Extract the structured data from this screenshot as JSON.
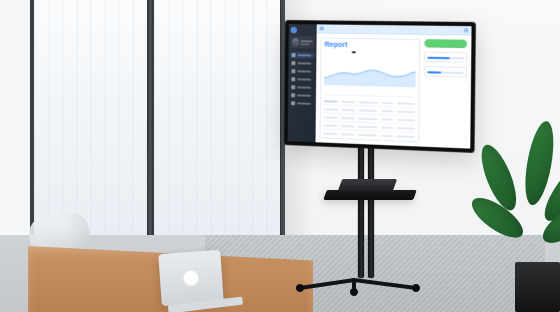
{
  "tv_app": {
    "sidebar": {
      "brand": "",
      "nav_items": [
        "",
        "",
        "",
        "",
        "",
        "",
        "",
        ""
      ]
    },
    "topbar": {
      "left": "",
      "right": ""
    },
    "main": {
      "title": "Report",
      "subtitle": "",
      "tooltip": ""
    },
    "right_panel": {
      "button_label": "",
      "kpi_1_title": "",
      "kpi_1_value": "",
      "kpi_2_title": "",
      "kpi_2_value": ""
    }
  }
}
